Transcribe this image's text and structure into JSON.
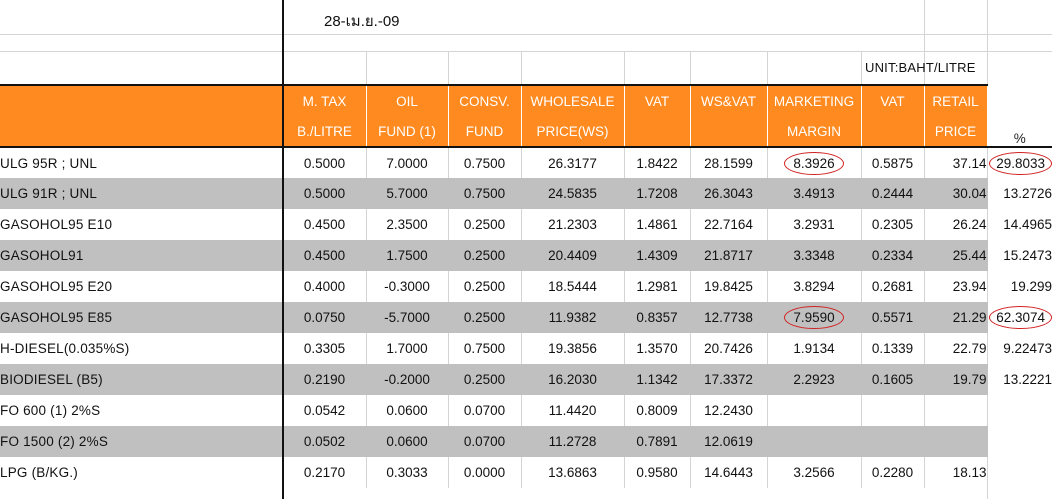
{
  "date": "28-เม.ย.-09",
  "unit": "UNIT:BAHT/LITRE",
  "header_row1": [
    "",
    "M. TAX",
    "OIL",
    "CONSV.",
    "WHOLESALE",
    "VAT",
    "WS&VAT",
    "MARKETING",
    "VAT",
    "RETAIL"
  ],
  "header_row2": [
    "",
    "B./LITRE",
    "FUND (1)",
    "FUND",
    "PRICE(WS)",
    "",
    "",
    "MARGIN",
    "",
    "PRICE",
    "%"
  ],
  "rows": [
    {
      "name": "ULG 95R ; UNL",
      "mtax": "0.5000",
      "oilfund": "7.0000",
      "consv": "0.7500",
      "wholesale": "26.3177",
      "vat": "1.8422",
      "wsvat": "28.1599",
      "margin": "8.3926",
      "vat2": "0.5875",
      "retail": "37.14",
      "pct": "29.8033"
    },
    {
      "name": "ULG 91R ; UNL",
      "mtax": "0.5000",
      "oilfund": "5.7000",
      "consv": "0.7500",
      "wholesale": "24.5835",
      "vat": "1.7208",
      "wsvat": "26.3043",
      "margin": "3.4913",
      "vat2": "0.2444",
      "retail": "30.04",
      "pct": "13.2726"
    },
    {
      "name": "GASOHOL95 E10",
      "mtax": "0.4500",
      "oilfund": "2.3500",
      "consv": "0.2500",
      "wholesale": "21.2303",
      "vat": "1.4861",
      "wsvat": "22.7164",
      "margin": "3.2931",
      "vat2": "0.2305",
      "retail": "26.24",
      "pct": "14.4965"
    },
    {
      "name": "GASOHOL91",
      "mtax": "0.4500",
      "oilfund": "1.7500",
      "consv": "0.2500",
      "wholesale": "20.4409",
      "vat": "1.4309",
      "wsvat": "21.8717",
      "margin": "3.3348",
      "vat2": "0.2334",
      "retail": "25.44",
      "pct": "15.2473"
    },
    {
      "name": "GASOHOL95 E20",
      "mtax": "0.4000",
      "oilfund": "-0.3000",
      "consv": "0.2500",
      "wholesale": "18.5444",
      "vat": "1.2981",
      "wsvat": "19.8425",
      "margin": "3.8294",
      "vat2": "0.2681",
      "retail": "23.94",
      "pct": "19.299"
    },
    {
      "name": "GASOHOL95 E85",
      "mtax": "0.0750",
      "oilfund": "-5.7000",
      "consv": "0.2500",
      "wholesale": "11.9382",
      "vat": "0.8357",
      "wsvat": "12.7738",
      "margin": "7.9590",
      "vat2": "0.5571",
      "retail": "21.29",
      "pct": "62.3074"
    },
    {
      "name": "H-DIESEL(0.035%S)",
      "mtax": "0.3305",
      "oilfund": "1.7000",
      "consv": "0.7500",
      "wholesale": "19.3856",
      "vat": "1.3570",
      "wsvat": "20.7426",
      "margin": "1.9134",
      "vat2": "0.1339",
      "retail": "22.79",
      "pct": "9.22473"
    },
    {
      "name": "BIODIESEL (B5)",
      "mtax": "0.2190",
      "oilfund": "-0.2000",
      "consv": "0.2500",
      "wholesale": "16.2030",
      "vat": "1.1342",
      "wsvat": "17.3372",
      "margin": "2.2923",
      "vat2": "0.1605",
      "retail": "19.79",
      "pct": "13.2221"
    },
    {
      "name": "FO 600 (1) 2%S",
      "mtax": "0.0542",
      "oilfund": "0.0600",
      "consv": "0.0700",
      "wholesale": "11.4420",
      "vat": "0.8009",
      "wsvat": "12.2430",
      "margin": "",
      "vat2": "",
      "retail": "",
      "pct": ""
    },
    {
      "name": "FO 1500 (2) 2%S",
      "mtax": "0.0502",
      "oilfund": "0.0600",
      "consv": "0.0700",
      "wholesale": "11.2728",
      "vat": "0.7891",
      "wsvat": "12.0619",
      "margin": "",
      "vat2": "",
      "retail": "",
      "pct": ""
    },
    {
      "name": "LPG (B/KG.)",
      "mtax": "0.2170",
      "oilfund": "0.3033",
      "consv": "0.0000",
      "wholesale": "13.6863",
      "vat": "0.9580",
      "wsvat": "14.6443",
      "margin": "3.2566",
      "vat2": "0.2280",
      "retail": "18.13",
      "pct": ""
    }
  ],
  "circled": [
    "row0.margin",
    "row0.pct",
    "row5.margin",
    "row5.pct"
  ],
  "colors": {
    "header": "#ff8a1f",
    "alt_row": "#c0c0c0",
    "circle": "#d22222"
  }
}
